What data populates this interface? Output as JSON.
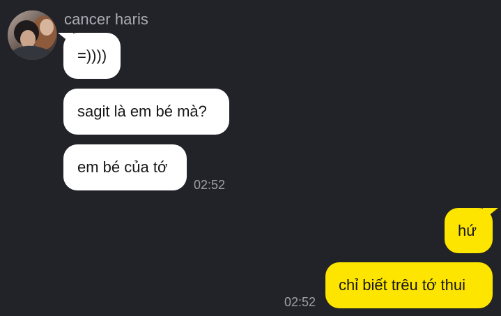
{
  "chat": {
    "sender_name": "cancer haris",
    "incoming_messages": [
      {
        "text": "=))))"
      },
      {
        "text": "sagit là em bé mà?"
      },
      {
        "text": "em bé của tớ"
      }
    ],
    "incoming_time": "02:52",
    "outgoing_messages": [
      {
        "text": "hứ"
      },
      {
        "text": "chỉ biết trêu tớ thui"
      }
    ],
    "outgoing_time": "02:52"
  },
  "colors": {
    "background": "#212328",
    "incoming_bubble": "#ffffff",
    "outgoing_bubble": "#fee500",
    "secondary_text": "#a9adb3"
  },
  "icons": {
    "avatar": "profile-photo"
  }
}
